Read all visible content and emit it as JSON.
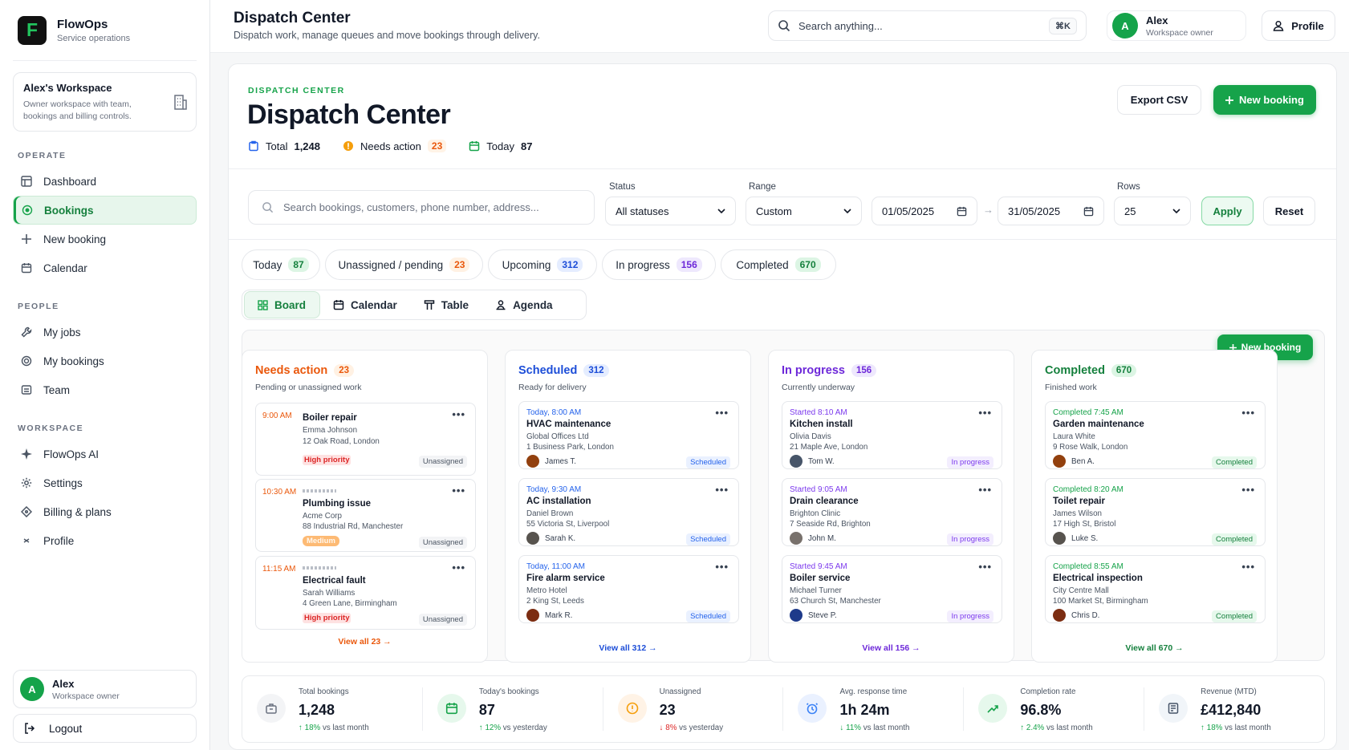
{
  "brand": {
    "name": "FlowOps",
    "tagline": "Service operations"
  },
  "workspace_card": {
    "title": "Alex's Workspace",
    "desc": "Owner workspace with team, bookings and billing controls."
  },
  "sidebar": {
    "sections": [
      {
        "label": "OPERATE",
        "items": [
          {
            "label": "Dashboard",
            "icon": "dashboard-icon"
          },
          {
            "label": "Bookings",
            "icon": "bookings-icon",
            "active": true
          },
          {
            "label": "New booking",
            "icon": "plus-icon"
          },
          {
            "label": "Calendar",
            "icon": "calendar-icon"
          }
        ]
      },
      {
        "label": "PEOPLE",
        "items": [
          {
            "label": "My jobs",
            "icon": "wrench-icon"
          },
          {
            "label": "My bookings",
            "icon": "target-icon"
          },
          {
            "label": "Team",
            "icon": "team-icon"
          }
        ]
      },
      {
        "label": "WORKSPACE",
        "items": [
          {
            "label": "FlowOps AI",
            "icon": "sparkle-icon"
          },
          {
            "label": "Settings",
            "icon": "gear-icon"
          },
          {
            "label": "Billing & plans",
            "icon": "tag-icon"
          },
          {
            "label": "Profile",
            "icon": "profile-icon"
          }
        ]
      }
    ],
    "user": {
      "initial": "A",
      "name": "Alex",
      "role": "Workspace owner"
    },
    "logout": "Logout"
  },
  "topbar": {
    "title": "Dispatch Center",
    "subtitle": "Dispatch work, manage queues and move bookings through delivery.",
    "search_placeholder": "Search anything...",
    "shortcut": "⌘K",
    "user": {
      "initial": "A",
      "name": "Alex",
      "role": "Workspace owner"
    },
    "profile": "Profile"
  },
  "header": {
    "eyebrow": "DISPATCH CENTER",
    "title": "Dispatch Center",
    "stats": {
      "total_label": "Total",
      "total": "1,248",
      "needs_label": "Needs action",
      "needs": "23",
      "today_label": "Today",
      "today": "87"
    },
    "export": "Export CSV",
    "new_booking": "New booking"
  },
  "filters": {
    "search_placeholder": "Search bookings, customers, phone number, address...",
    "status_label": "Status",
    "status_value": "All statuses",
    "range_label": "Range",
    "range_value": "Custom",
    "date_from": "01/05/2025",
    "date_to": "31/05/2025",
    "rows_label": "Rows",
    "rows_value": "25",
    "apply": "Apply",
    "reset": "Reset"
  },
  "quick_filters": [
    {
      "label": "Today",
      "count": "87"
    },
    {
      "label": "Unassigned / pending",
      "count": "23"
    },
    {
      "label": "Upcoming",
      "count": "312"
    },
    {
      "label": "In progress",
      "count": "156"
    },
    {
      "label": "Completed",
      "count": "670"
    }
  ],
  "views": [
    {
      "label": "Board",
      "icon": "board-icon",
      "active": true
    },
    {
      "label": "Calendar",
      "icon": "calendar-icon"
    },
    {
      "label": "Table",
      "icon": "table-icon"
    },
    {
      "label": "Agenda",
      "icon": "agenda-icon"
    }
  ],
  "board": {
    "new_booking": "New booking",
    "columns": [
      {
        "title": "Needs action",
        "count": "23",
        "subtitle": "Pending or unassigned work",
        "footer": "View all 23 →",
        "color": "#ea580c",
        "cards": [
          {
            "time": "9:00 AM",
            "title": "Boiler repair",
            "line1": "Emma Johnson",
            "line2": "12 Oak Road, London",
            "priority": "High priority",
            "tag": "Unassigned"
          },
          {
            "time": "10:30 AM",
            "title": "Plumbing issue",
            "line1": "Acme Corp",
            "line2": "88 Industrial Rd, Manchester",
            "priority": "Medium",
            "tag": "Unassigned"
          },
          {
            "time": "11:15 AM",
            "title": "Electrical fault",
            "line1": "Sarah Williams",
            "line2": "4 Green Lane, Birmingham",
            "priority": "High priority",
            "tag": "Unassigned"
          }
        ]
      },
      {
        "title": "Scheduled",
        "count": "312",
        "subtitle": "Ready for delivery",
        "footer": "View all 312 →",
        "color": "#1d4ed8",
        "cards": [
          {
            "time": "Today, 8:00 AM",
            "title": "HVAC maintenance",
            "line1": "Global Offices Ltd",
            "line2": "1 Business Park, London",
            "person": "James T.",
            "tag": "Scheduled"
          },
          {
            "time": "Today, 9:30 AM",
            "title": "AC installation",
            "line1": "Daniel Brown",
            "line2": "55 Victoria St, Liverpool",
            "person": "Sarah K.",
            "tag": "Scheduled"
          },
          {
            "time": "Today, 11:00 AM",
            "title": "Fire alarm service",
            "line1": "Metro Hotel",
            "line2": "2 King St, Leeds",
            "person": "Mark R.",
            "tag": "Scheduled"
          }
        ]
      },
      {
        "title": "In progress",
        "count": "156",
        "subtitle": "Currently underway",
        "footer": "View all 156 →",
        "color": "#6d28d9",
        "cards": [
          {
            "time": "Started 8:10 AM",
            "title": "Kitchen install",
            "line1": "Olivia Davis",
            "line2": "21 Maple Ave, London",
            "person": "Tom W.",
            "tag": "In progress"
          },
          {
            "time": "Started 9:05 AM",
            "title": "Drain clearance",
            "line1": "Brighton Clinic",
            "line2": "7 Seaside Rd, Brighton",
            "person": "John M.",
            "tag": "In progress"
          },
          {
            "time": "Started 9:45 AM",
            "title": "Boiler service",
            "line1": "Michael Turner",
            "line2": "63 Church St, Manchester",
            "person": "Steve P.",
            "tag": "In progress"
          }
        ]
      },
      {
        "title": "Completed",
        "count": "670",
        "subtitle": "Finished work",
        "footer": "View all 670 →",
        "color": "#15803d",
        "cards": [
          {
            "time": "Completed 7:45 AM",
            "title": "Garden maintenance",
            "line1": "Laura White",
            "line2": "9 Rose Walk, London",
            "person": "Ben A.",
            "tag": "Completed"
          },
          {
            "time": "Completed 8:20 AM",
            "title": "Toilet repair",
            "line1": "James Wilson",
            "line2": "17 High St, Bristol",
            "person": "Luke S.",
            "tag": "Completed"
          },
          {
            "time": "Completed 8:55 AM",
            "title": "Electrical inspection",
            "line1": "City Centre Mall",
            "line2": "100 Market St, Birmingham",
            "person": "Chris D.",
            "tag": "Completed"
          }
        ]
      }
    ]
  },
  "summary": [
    {
      "label": "Total bookings",
      "value": "1,248",
      "delta": "↑ 18%",
      "delta_text": " vs last month",
      "dir": "up",
      "icon": "briefcase-icon"
    },
    {
      "label": "Today's bookings",
      "value": "87",
      "delta": "↑ 12%",
      "delta_text": " vs yesterday",
      "dir": "up",
      "icon": "calendar-icon"
    },
    {
      "label": "Unassigned",
      "value": "23",
      "delta": "↓ 8%",
      "delta_text": " vs yesterday",
      "dir": "down",
      "icon": "alert-icon"
    },
    {
      "label": "Avg. response time",
      "value": "1h 24m",
      "delta": "↓ 11%",
      "delta_text": " vs last month",
      "dir": "up",
      "icon": "clock-icon"
    },
    {
      "label": "Completion rate",
      "value": "96.8%",
      "delta": "↑ 2.4%",
      "delta_text": " vs last month",
      "dir": "up",
      "icon": "trend-icon"
    },
    {
      "label": "Revenue (MTD)",
      "value": "£412,840",
      "delta": "↑ 18%",
      "delta_text": " vs last month",
      "dir": "up",
      "icon": "receipt-icon"
    }
  ]
}
